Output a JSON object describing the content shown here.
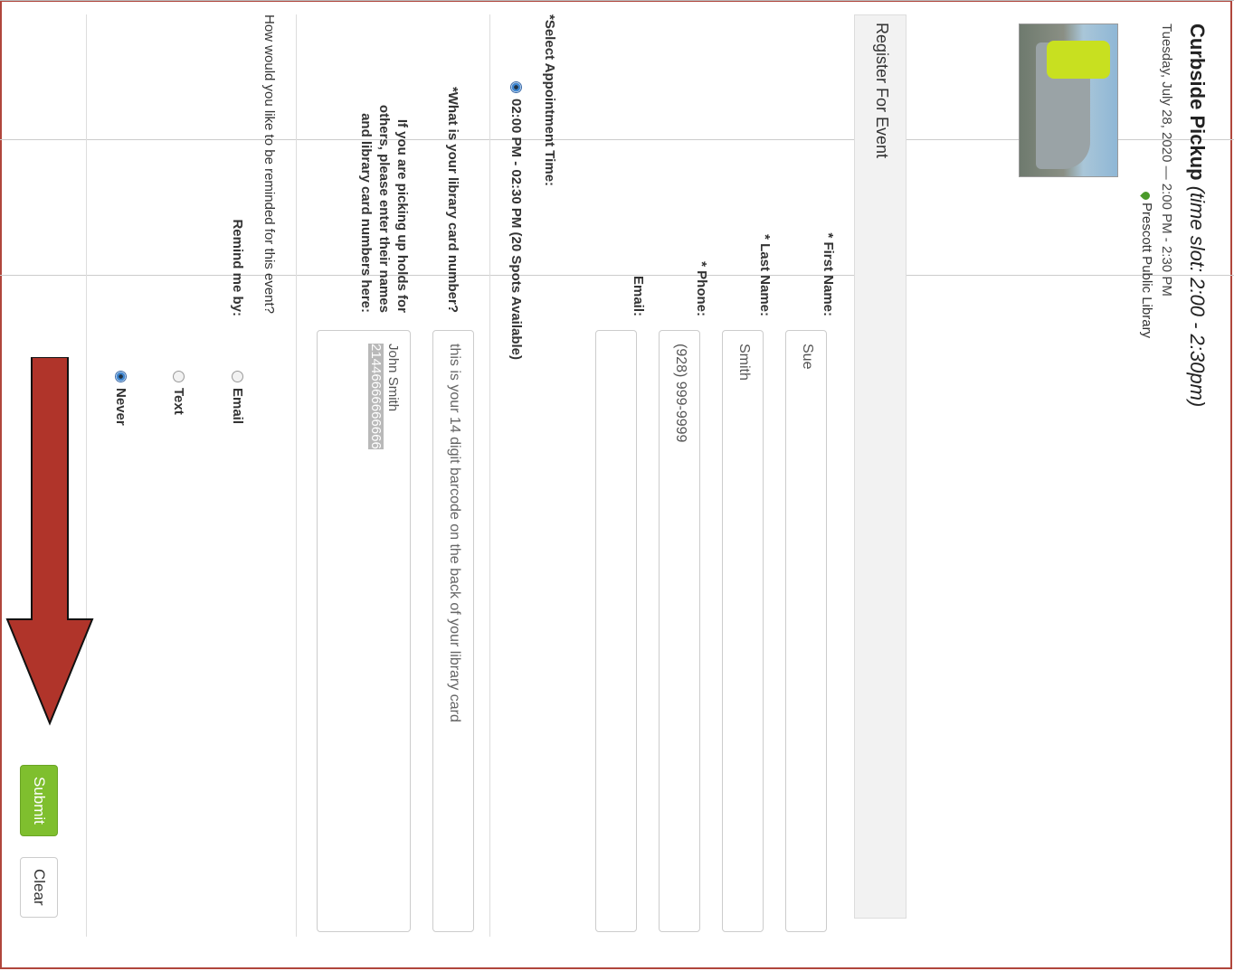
{
  "event": {
    "title_bold": "Curbside Pickup",
    "title_italic": "(time slot: 2:00 - 2:30pm)",
    "date": "Tuesday, July 28, 2020  —  2:00 PM - 2:30 PM",
    "location": "Prescott Public Library"
  },
  "panel": {
    "heading": "Register For Event"
  },
  "form": {
    "first_name_label": "* First Name:",
    "first_name_value": "Sue",
    "last_name_label": "* Last Name:",
    "last_name_value": "Smith",
    "phone_label": "* Phone:",
    "phone_value": "(928) 999-9999",
    "email_label": "Email:",
    "email_value": "",
    "appointment_label": "*Select Appointment Time:",
    "appointment_option": "02:00 PM - 02:30 PM    (20 Spots Available)",
    "library_card_label": "*What is your library card number?",
    "library_card_placeholder": "this is your 14 digit barcode on the back of your library card",
    "holds_label_line1": "If you are picking up holds for",
    "holds_label_line2": "others, please enter their names",
    "holds_label_line3": "and library card numbers here:",
    "holds_line1": "John Smith",
    "holds_line2": "21446666666666",
    "remind_question": "How would you like to be reminded for this event?",
    "remind_label": "Remind me by:",
    "remind_options": [
      "Email",
      "Text",
      "Never"
    ],
    "remind_selected": "Never",
    "submit_label": "Submit",
    "clear_label": "Clear"
  },
  "colors": {
    "submit": "#7fbf2e",
    "arrow": "#b0342a",
    "frame": "#b0463c"
  }
}
